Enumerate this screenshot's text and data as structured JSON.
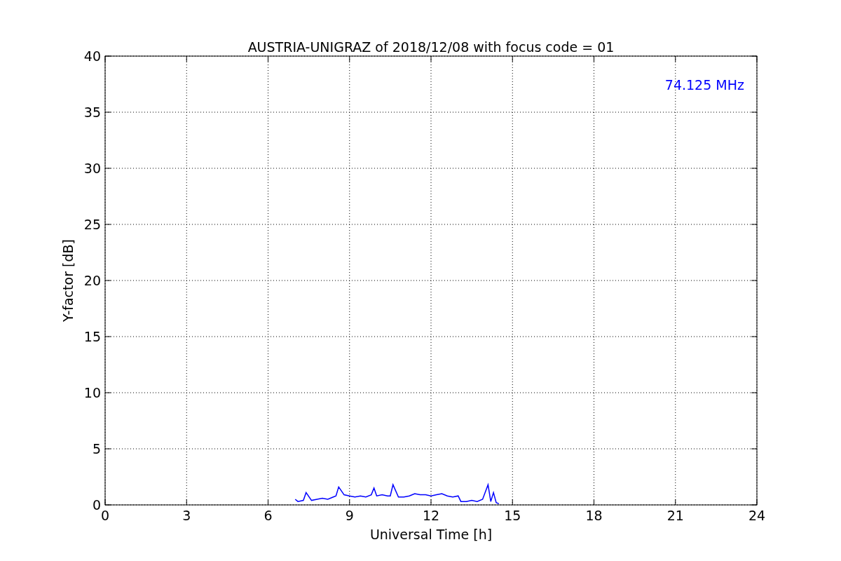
{
  "chart_data": {
    "type": "line",
    "title": "AUSTRIA-UNIGRAZ of 2018/12/08 with focus code = 01",
    "xlabel": "Universal Time [h]",
    "ylabel": "Y-factor [dB]",
    "x": [
      7.0,
      7.1,
      7.3,
      7.4,
      7.6,
      7.8,
      8.0,
      8.2,
      8.4,
      8.5,
      8.6,
      8.8,
      9.0,
      9.2,
      9.4,
      9.6,
      9.8,
      9.9,
      10.0,
      10.2,
      10.4,
      10.5,
      10.6,
      10.8,
      11.0,
      11.2,
      11.4,
      11.6,
      11.8,
      12.0,
      12.2,
      12.4,
      12.6,
      12.8,
      13.0,
      13.1,
      13.3,
      13.5,
      13.7,
      13.9,
      14.1,
      14.2,
      14.3,
      14.4,
      14.5
    ],
    "series": [
      {
        "name": "74.125 MHz",
        "color": "#0000ff",
        "values": [
          0.5,
          0.3,
          0.4,
          1.1,
          0.4,
          0.5,
          0.6,
          0.5,
          0.7,
          0.8,
          1.6,
          0.9,
          0.8,
          0.7,
          0.8,
          0.7,
          0.9,
          1.5,
          0.8,
          0.9,
          0.8,
          0.8,
          1.8,
          0.7,
          0.7,
          0.8,
          1.0,
          0.9,
          0.9,
          0.8,
          0.9,
          1.0,
          0.8,
          0.7,
          0.8,
          0.3,
          0.3,
          0.4,
          0.3,
          0.5,
          1.8,
          0.3,
          1.1,
          0.2,
          0.1
        ]
      }
    ],
    "xlim": [
      0,
      24
    ],
    "ylim": [
      0,
      40
    ],
    "grid": true,
    "xticks": [
      0,
      3,
      6,
      9,
      12,
      15,
      18,
      21,
      24
    ],
    "yticks": [
      0,
      5,
      10,
      15,
      20,
      25,
      30,
      35,
      40
    ]
  }
}
